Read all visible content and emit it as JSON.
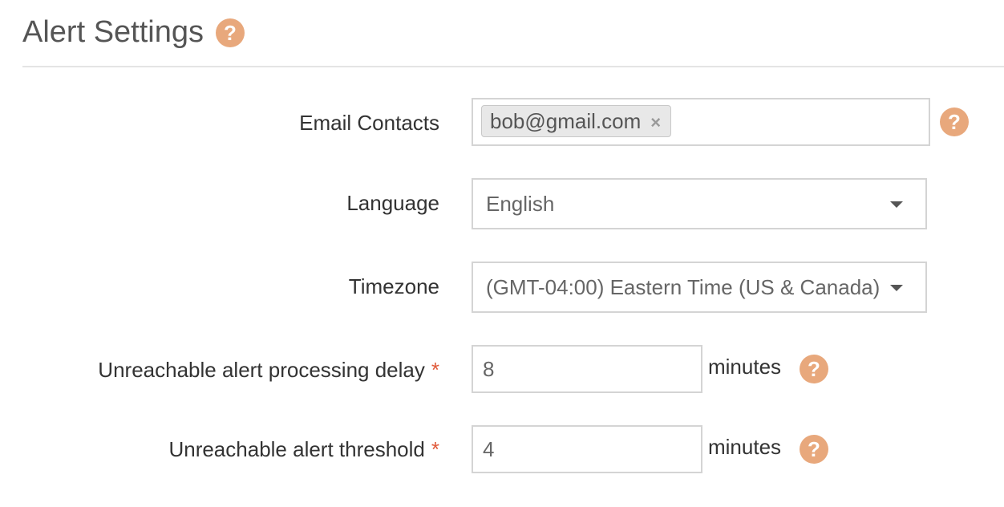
{
  "header": {
    "title": "Alert Settings",
    "help_icon": "question-circle-icon"
  },
  "colors": {
    "help_icon": "#e8a87c",
    "required_star": "#e05a3a",
    "border": "#d4d4d4"
  },
  "form": {
    "email_contacts": {
      "label": "Email Contacts",
      "tags": [
        "bob@gmail.com"
      ],
      "remove_glyph": "×",
      "help_icon": "question-circle-icon"
    },
    "language": {
      "label": "Language",
      "selected": "English",
      "dropdown_icon": "caret-down-icon"
    },
    "timezone": {
      "label": "Timezone",
      "selected": "(GMT-04:00) Eastern Time (US & Canada)",
      "dropdown_icon": "caret-down-icon"
    },
    "processing_delay": {
      "label": "Unreachable alert processing delay",
      "required_marker": "*",
      "value": "8",
      "unit": "minutes",
      "help_icon": "question-circle-icon"
    },
    "threshold": {
      "label": "Unreachable alert threshold",
      "required_marker": "*",
      "value": "4",
      "unit": "minutes",
      "help_icon": "question-circle-icon"
    }
  }
}
